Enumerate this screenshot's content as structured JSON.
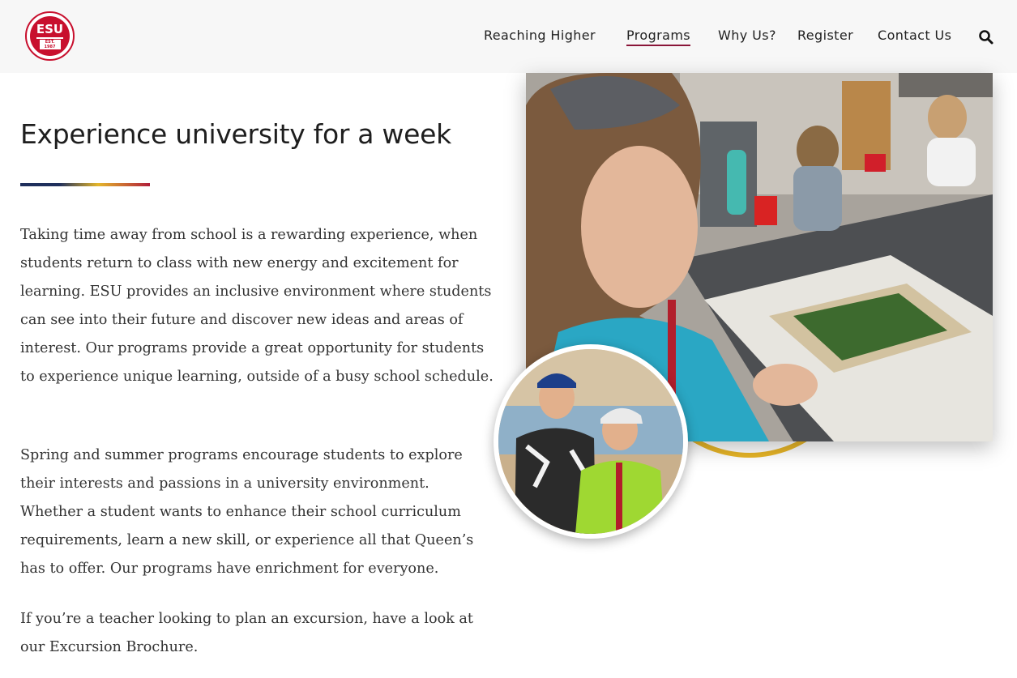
{
  "header": {
    "logo": {
      "text": "ESU",
      "est": "EST. 1987"
    },
    "nav": [
      {
        "label": "Reaching Higher",
        "active": false
      },
      {
        "label": "Programs",
        "active": true
      },
      {
        "label": "Why Us?",
        "active": false
      },
      {
        "label": "Register",
        "active": false
      },
      {
        "label": "Contact Us",
        "active": false
      }
    ],
    "search_icon": "search-icon"
  },
  "main": {
    "title": "Experience university for a week",
    "paragraphs": [
      "Taking time away from school is a rewarding experience, when students return to class with new energy and excitement for learning. ESU provides an inclusive environment where students can see into their future and discover new ideas and areas of interest. Our programs provide a great opportunity for students to experience unique learning, outside of a busy school schedule.",
      "Spring and summer programs encourage students to explore their interests and passions in a university environment. Whether a student wants to enhance their school curriculum requirements, learn a new skill, or experience all that Queen’s has to offer. Our programs have enrichment for everyone.",
      "If you’re a teacher looking to plan an excursion, have a look at our Excursion Brochure."
    ]
  },
  "colors": {
    "brand_red": "#c8102e",
    "nav_underline": "#8a1538",
    "accent_navy": "#1f2f5c",
    "accent_gold": "#e4b62c",
    "accent_crimson": "#b11e3b"
  }
}
